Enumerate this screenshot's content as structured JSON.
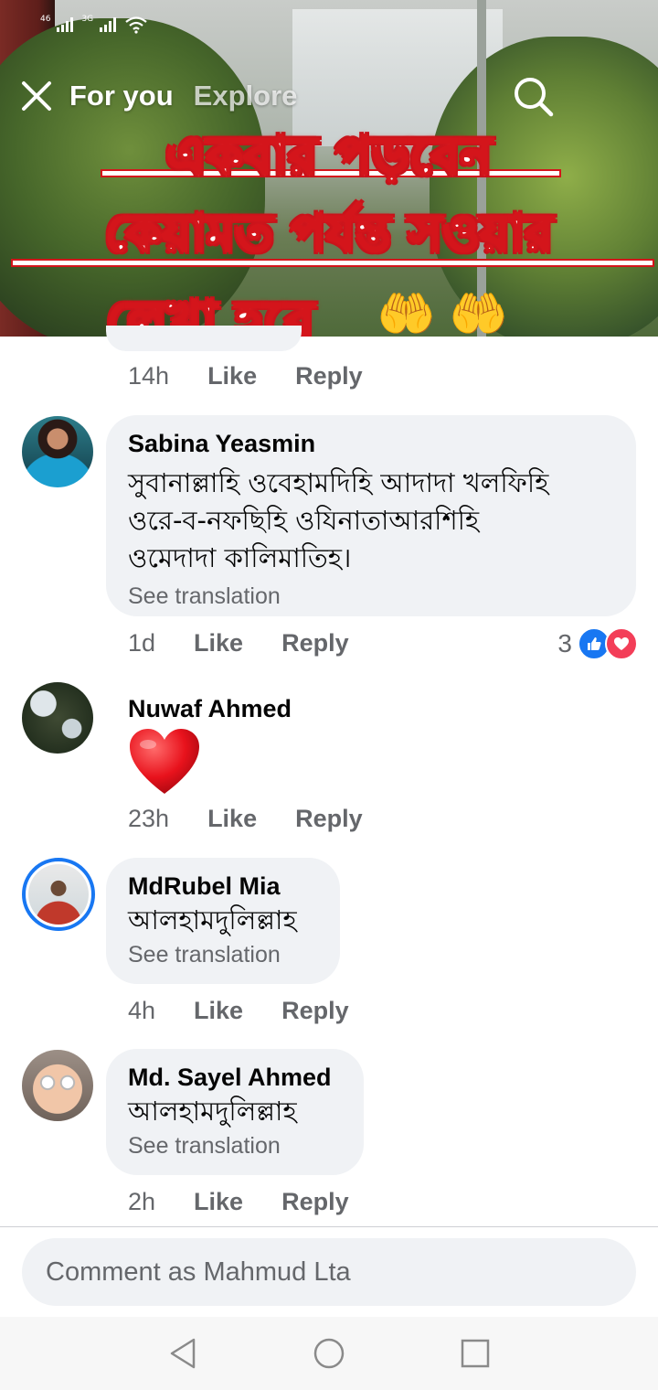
{
  "status_bar": {
    "sim1": "46",
    "sim2": "3G"
  },
  "video": {
    "tabs": [
      {
        "label": "For you"
      },
      {
        "label": "Explore"
      }
    ],
    "overlay_lines": [
      "একবার পড়বেন",
      "কেয়ামত পর্যন্ত সওয়ার",
      "লেখা হবে"
    ],
    "hands_emoji": "🤲 🤲"
  },
  "comments": [
    {
      "time": "14h",
      "like": "Like",
      "reply": "Reply"
    },
    {
      "name": "Sabina Yeasmin",
      "text_lines": [
        "সুবানাল্লাহি ওবেহামদিহি আদাদা খলফিহি",
        "ওরে-ব-নফছিহি ওযিনাতাআরশিহি",
        "ওমেদাদা কালিমাতিহ।"
      ],
      "see_translation": "See translation",
      "time": "1d",
      "like": "Like",
      "reply": "Reply",
      "reaction_count": "3"
    },
    {
      "name": "Nuwaf Ahmed",
      "emoji": "❤️",
      "time": "23h",
      "like": "Like",
      "reply": "Reply"
    },
    {
      "name": "MdRubel Mia",
      "text": "আলহামদুলিল্লাহ",
      "see_translation": "See translation",
      "time": "4h",
      "like": "Like",
      "reply": "Reply"
    },
    {
      "name": "Md. Sayel Ahmed",
      "text": "আলহামদুলিল্লাহ",
      "see_translation": "See translation",
      "time": "2h",
      "like": "Like",
      "reply": "Reply"
    }
  ],
  "composer": {
    "placeholder": "Comment as Mahmud Lta"
  },
  "colors": {
    "bubble": "#f0f2f5",
    "meta": "#65676b",
    "like_blue": "#1877f2",
    "love_red": "#f33e58",
    "overlay_red": "#d4151b"
  }
}
